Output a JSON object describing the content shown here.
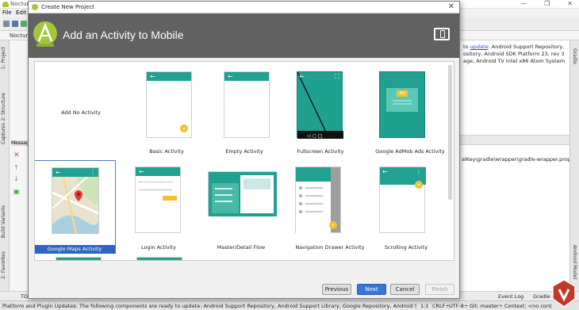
{
  "ide": {
    "title": "Noctur",
    "menu": [
      "File",
      "Edit"
    ],
    "navbar_text": "Noctur",
    "left_tabs": [
      "1: Project",
      "2: Structure",
      "Captures",
      "Build Variants",
      "2: Favorites"
    ],
    "right_tabs": [
      "Gradle",
      "Android Model"
    ],
    "update_panel": {
      "link": "update",
      "prefix": "to ",
      "line1_rest": ": Android Support Repository,",
      "line2": "ository, Android SDK Platform 23, rev 3",
      "line3": "age, Android TV Intel x86 Atom System"
    },
    "messages_label": "Messag",
    "gradle_path": "alKey\\gradle\\wrapper\\gradle-wrapper.propert",
    "bottom_tabs": {
      "left": "TO",
      "event_log": "Event Log",
      "gradle_console": "Gradle Co"
    },
    "status": {
      "message": "Platform and Plugin Updates: The following components are ready to update: Android Support Repository, Android Support Library, Google Repository, Android S... (3 minutes ago)",
      "position": "1:1",
      "line_sep": "CRLF÷",
      "encoding": "UTF-8÷",
      "vcs": "Git: master÷",
      "context": "Context: <no context>"
    }
  },
  "dialog": {
    "title": "Create New Project",
    "header": "Add an Activity to Mobile",
    "activities": [
      {
        "label": "Add No Activity"
      },
      {
        "label": "Basic Activity"
      },
      {
        "label": "Empty Activity"
      },
      {
        "label": "Fullscreen Activity"
      },
      {
        "label": "Google AdMob Ads Activity",
        "badge": "Ad"
      },
      {
        "label": "Google Maps Activity",
        "selected": true
      },
      {
        "label": "Login Activity"
      },
      {
        "label": "Master/Detail Flow"
      },
      {
        "label": "Navigation Drawer Activity"
      },
      {
        "label": "Scrolling Activity"
      }
    ],
    "buttons": {
      "previous": "Previous",
      "next": "Next",
      "cancel": "Cancel",
      "finish": "Finish"
    }
  },
  "colors": {
    "accent_teal": "#21a191",
    "header_bg": "#616161",
    "fab_yellow": "#f2c12e",
    "selection_blue": "#2f65c4"
  }
}
